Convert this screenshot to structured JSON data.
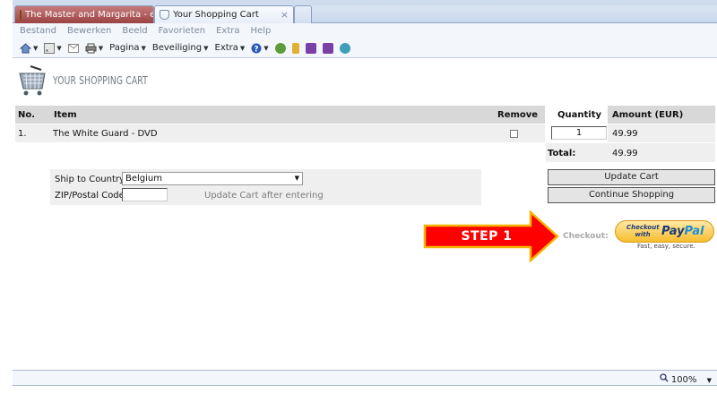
{
  "browser": {
    "tabs": [
      {
        "label": "The Master and Margarita - e-s...",
        "active": false
      },
      {
        "label": "Your Shopping Cart",
        "active": true
      }
    ],
    "tab_close_glyph": "×",
    "menu": [
      "Bestand",
      "Bewerken",
      "Beeld",
      "Favorieten",
      "Extra",
      "Help"
    ],
    "commands": {
      "page": "Pagina",
      "security": "Beveiliging",
      "extra": "Extra"
    },
    "zoom": "100%"
  },
  "page": {
    "title": "YOUR SHOPPING CART",
    "table": {
      "headers": {
        "no": "No.",
        "item": "Item",
        "remove": "Remove",
        "quantity": "Quantity",
        "amount": "Amount (EUR)"
      },
      "rows": [
        {
          "no": "1.",
          "item": "The White Guard - DVD",
          "quantity": "1",
          "amount": "49.99"
        }
      ],
      "total_label": "Total:",
      "total_value": "49.99"
    },
    "shipping": {
      "country_label": "Ship to Country",
      "country_value": "Belgium",
      "zip_label": "ZIP/Postal Code",
      "zip_value": "",
      "zip_note": "Update Cart after entering"
    },
    "buttons": {
      "update": "Update Cart",
      "continue": "Continue Shopping"
    },
    "step_label": "STEP 1",
    "checkout_label": "Checkout:",
    "paypal": {
      "small": "Checkout with",
      "brand_pay": "Pay",
      "brand_pal": "Pal",
      "tagline": "Fast, easy, secure."
    }
  },
  "colors": {
    "arrow_red": "#ff0000",
    "arrow_border": "#f5b400",
    "paypal_gold": "#f7bd2e",
    "paypal_blue": "#1b3a7a"
  }
}
